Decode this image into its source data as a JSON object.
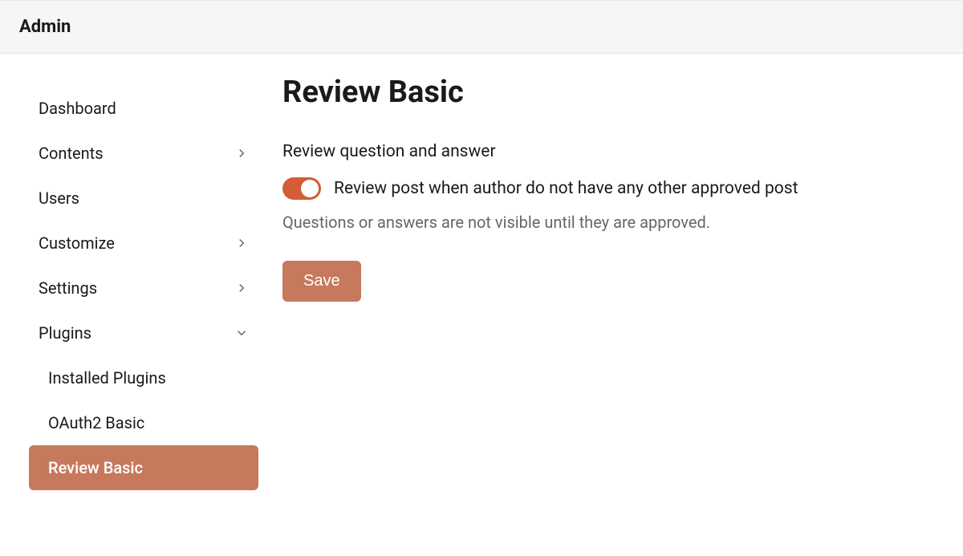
{
  "header": {
    "title": "Admin"
  },
  "sidebar": {
    "items": [
      {
        "label": "Dashboard",
        "chevron": null
      },
      {
        "label": "Contents",
        "chevron": "right"
      },
      {
        "label": "Users",
        "chevron": null
      },
      {
        "label": "Customize",
        "chevron": "right"
      },
      {
        "label": "Settings",
        "chevron": "right"
      },
      {
        "label": "Plugins",
        "chevron": "down"
      }
    ],
    "subitems": [
      {
        "label": "Installed Plugins",
        "active": false
      },
      {
        "label": "OAuth2 Basic",
        "active": false
      },
      {
        "label": "Review Basic",
        "active": true
      }
    ]
  },
  "main": {
    "title": "Review Basic",
    "section_label": "Review question and answer",
    "toggle": {
      "on": true,
      "label": "Review post when author do not have any other approved post"
    },
    "help_text": "Questions or answers are not visible until they are approved.",
    "save_label": "Save"
  },
  "colors": {
    "accent": "#c6795d",
    "toggle_on": "#d45c36"
  }
}
